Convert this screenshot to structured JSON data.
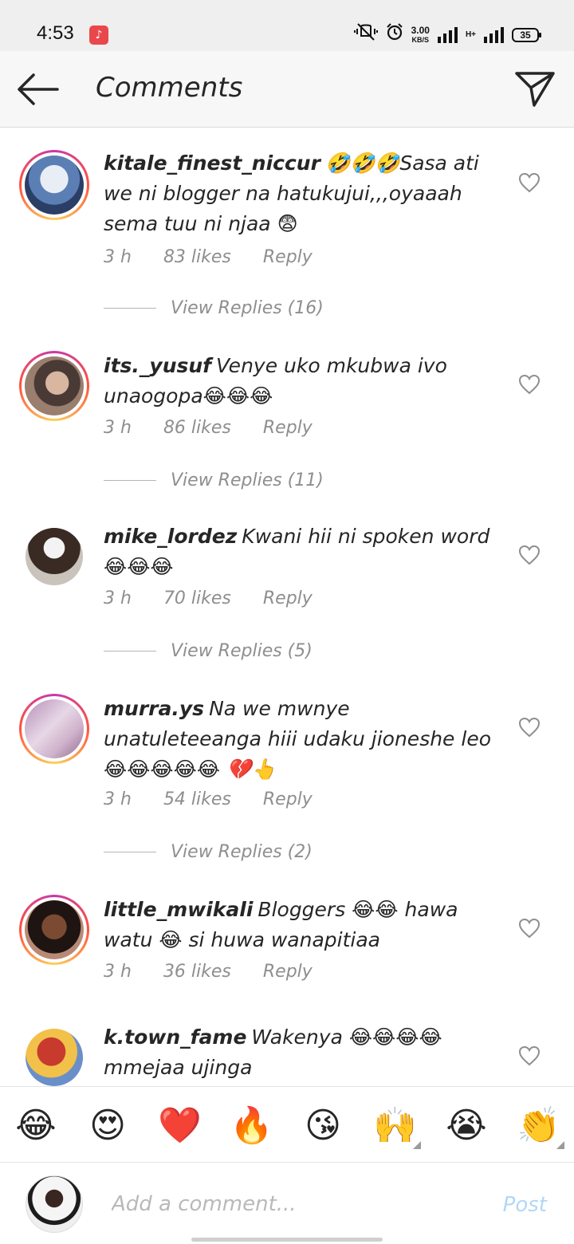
{
  "status_bar": {
    "time": "4:53",
    "speed_value": "3.00",
    "speed_unit": "KB/S",
    "network_type": "H+",
    "battery": "35"
  },
  "header": {
    "title": "Comments",
    "back_icon": "arrow-left-icon",
    "send_icon": "paper-plane-icon"
  },
  "comments": [
    {
      "username": "kitale_finest_niccur",
      "text": "🤣🤣🤣Sasa ati we ni blogger na hatukujui,,,oyaaah sema tuu ni njaa 😨",
      "time": "3 h",
      "likes": "83 likes",
      "reply": "Reply",
      "view_replies": "View Replies (16)",
      "story_ring": true
    },
    {
      "username": "its._yusuf",
      "text": "Venye uko mkubwa ivo unaogopa😂😂😂",
      "time": "3 h",
      "likes": "86 likes",
      "reply": "Reply",
      "view_replies": "View Replies (11)",
      "story_ring": true
    },
    {
      "username": "mike_lordez",
      "text": "Kwani hii ni spoken word 😂😂😂",
      "time": "3 h",
      "likes": "70 likes",
      "reply": "Reply",
      "view_replies": "View Replies (5)",
      "story_ring": false
    },
    {
      "username": "murra.ys",
      "text": "Na we mwnye unatuleteeanga hiii udaku jioneshe leo😂😂😂😂😂 💔👆",
      "time": "3 h",
      "likes": "54 likes",
      "reply": "Reply",
      "view_replies": "View Replies (2)",
      "story_ring": true
    },
    {
      "username": "little_mwikali",
      "text": "Bloggers 😂😂 hawa watu 😂 si huwa wanapitiaa",
      "time": "3 h",
      "likes": "36 likes",
      "reply": "Reply",
      "story_ring": true
    },
    {
      "username": "k.town_fame",
      "text": "Wakenya 😂😂😂😂 mmejaa ujinga",
      "story_ring": false
    }
  ],
  "emoji_bar": [
    "😂",
    "😍",
    "❤️",
    "🔥",
    "😘",
    "🙌",
    "😭",
    "👏"
  ],
  "input": {
    "placeholder": "Add a comment...",
    "post_label": "Post"
  }
}
